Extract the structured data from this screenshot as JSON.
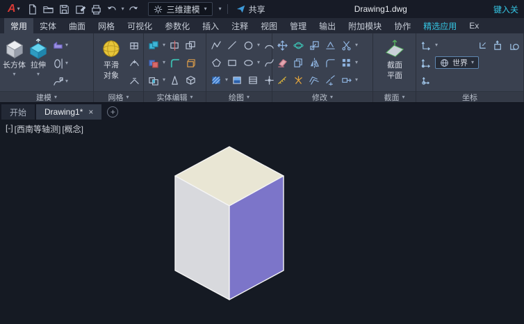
{
  "titlebar": {
    "logo": "A",
    "workspace": "三维建模",
    "share_label": "共享",
    "doc_title": "Drawing1.dwg",
    "search_text": "键入关",
    "accent_color": "#35c5e3"
  },
  "tabs": [
    "常用",
    "实体",
    "曲面",
    "网格",
    "可视化",
    "参数化",
    "插入",
    "注释",
    "视图",
    "管理",
    "输出",
    "附加模块",
    "协作",
    "精选应用",
    "Ex"
  ],
  "panels": {
    "modeling": {
      "label": "建模",
      "box": "长方体",
      "extrude": "拉伸"
    },
    "mesh": {
      "label": "网格",
      "smooth_line1": "平滑",
      "smooth_line2": "对象"
    },
    "solid": {
      "label": "实体编辑"
    },
    "draw": {
      "label": "绘图"
    },
    "modify": {
      "label": "修改"
    },
    "section": {
      "label": "截面",
      "plane_line1": "截面",
      "plane_line2": "平面"
    },
    "coords": {
      "label": "坐标",
      "ucs_current": "世界"
    }
  },
  "filetabs": {
    "start": "开始",
    "drawing": "Drawing1*",
    "close": "×",
    "new": "+"
  },
  "viewport": {
    "controls": [
      "[-]",
      "[西南等轴测]",
      "[概念]"
    ],
    "cube_colors": {
      "top": "#e9e6d4",
      "left": "#d8d9dd",
      "right": "#7c75c9",
      "edge": "#f4f4f4"
    },
    "background": "#151a23"
  }
}
